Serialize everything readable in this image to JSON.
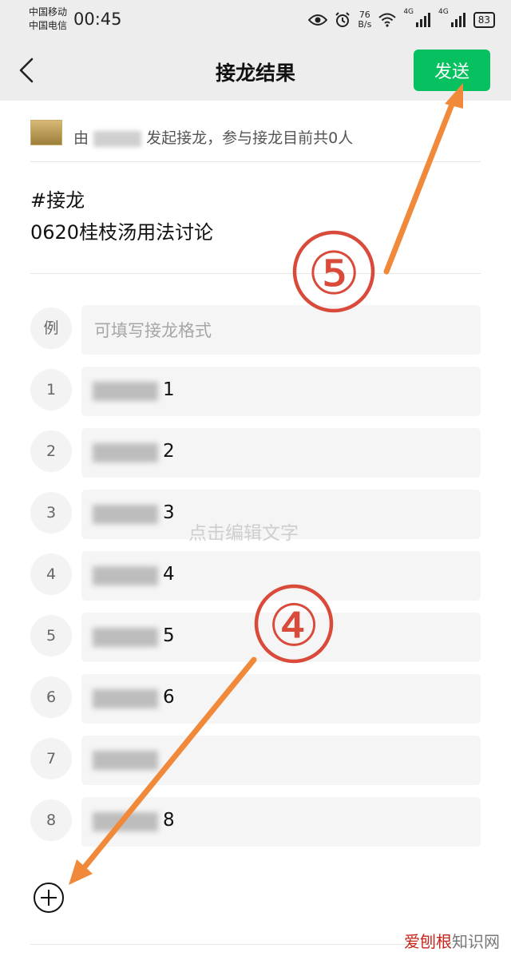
{
  "status_bar": {
    "carrier_1": "中国移动",
    "carrier_2": "中国电信",
    "time": "00:45",
    "net_speed_value": "76",
    "net_speed_unit": "B/s",
    "signal_1_label": "4G",
    "signal_2_label": "4G",
    "battery": "83",
    "icons": [
      "eye-icon",
      "alarm-icon",
      "wifi-icon",
      "signal-icon",
      "signal-icon",
      "battery-icon"
    ]
  },
  "navbar": {
    "title": "接龙结果",
    "send_label": "发送",
    "back_icon": "chevron-left-icon"
  },
  "initiator": {
    "prefix": "由",
    "suffix": "发起接龙，参与接龙目前共0人"
  },
  "topic": {
    "line1": "#接龙",
    "line2": "0620桂枝汤用法讨论"
  },
  "example": {
    "marker": "例",
    "placeholder": "可填写接龙格式"
  },
  "entries": [
    {
      "index": "1",
      "suffix": "1"
    },
    {
      "index": "2",
      "suffix": "2"
    },
    {
      "index": "3",
      "suffix": "3"
    },
    {
      "index": "4",
      "suffix": "4"
    },
    {
      "index": "5",
      "suffix": "5"
    },
    {
      "index": "6",
      "suffix": "6"
    },
    {
      "index": "7",
      "suffix": ""
    },
    {
      "index": "8",
      "suffix": "8"
    }
  ],
  "watermark": "点击编辑文字",
  "annotations": {
    "label_top": "⑤",
    "label_bottom": "④",
    "circle_color": "#d94a3a",
    "arrow_color": "#f08a3a"
  },
  "footer_logo": {
    "brand": "爱刨根",
    "rest": "知识网"
  },
  "colors": {
    "accent_green": "#07c160",
    "nav_background": "#ededed"
  }
}
